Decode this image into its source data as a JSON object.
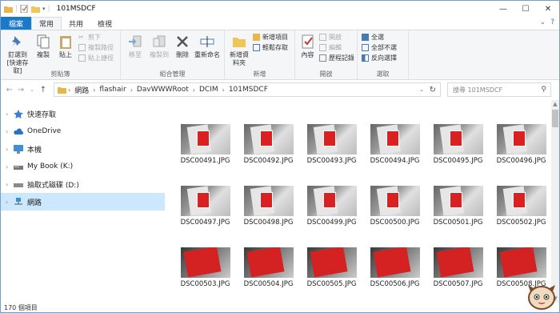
{
  "window": {
    "title": "101MSDCF",
    "controls": {
      "minimize": "—",
      "maximize": "☐",
      "close": "✕"
    }
  },
  "tabs": [
    {
      "label": "檔案"
    },
    {
      "label": "常用"
    },
    {
      "label": "共用"
    },
    {
      "label": "檢視"
    }
  ],
  "ribbon": {
    "clipboard": {
      "label": "剪貼簿",
      "pin": "釘選到 [快速存取]",
      "copy": "複製",
      "paste": "貼上",
      "cut": "剪下",
      "copy_path": "複製路徑",
      "paste_shortcut": "貼上捷徑"
    },
    "organize": {
      "label": "組合管理",
      "move_to": "移至",
      "copy_to": "複製到",
      "delete": "刪除",
      "rename": "重新命名"
    },
    "new": {
      "label": "新增",
      "new_folder": "新增資料夾",
      "new_item": "新增項目",
      "easy_access": "輕鬆存取"
    },
    "open": {
      "label": "開啟",
      "properties": "內容",
      "open": "開啟",
      "edit": "編輯",
      "history": "歷程記錄"
    },
    "select": {
      "label": "選取",
      "select_all": "全選",
      "select_none": "全部不選",
      "invert": "反向選擇"
    }
  },
  "address": {
    "crumbs": [
      "網路",
      "flashair",
      "DavWWWRoot",
      "DCIM",
      "101MSDCF"
    ],
    "search_placeholder": "搜尋 101MSDCF"
  },
  "sidebar": {
    "items": [
      {
        "label": "快速存取",
        "icon": "star-icon"
      },
      {
        "label": "OneDrive",
        "icon": "cloud-icon"
      },
      {
        "label": "本機",
        "icon": "computer-icon"
      },
      {
        "label": "My Book (K:)",
        "icon": "drive-icon"
      },
      {
        "label": "抽取式磁碟 (D:)",
        "icon": "removable-drive-icon"
      },
      {
        "label": "網路",
        "icon": "network-icon",
        "selected": true
      }
    ]
  },
  "files": [
    {
      "name": "DSC00491.JPG",
      "style": "card"
    },
    {
      "name": "DSC00492.JPG",
      "style": "card"
    },
    {
      "name": "DSC00493.JPG",
      "style": "card"
    },
    {
      "name": "DSC00494.JPG",
      "style": "card"
    },
    {
      "name": "DSC00495.JPG",
      "style": "card"
    },
    {
      "name": "DSC00496.JPG",
      "style": "card"
    },
    {
      "name": "DSC00497.JPG",
      "style": "card"
    },
    {
      "name": "DSC00498.JPG",
      "style": "card"
    },
    {
      "name": "DSC00499.JPG",
      "style": "card"
    },
    {
      "name": "DSC00500.JPG",
      "style": "card"
    },
    {
      "name": "DSC00501.JPG",
      "style": "card"
    },
    {
      "name": "DSC00502.JPG",
      "style": "card"
    },
    {
      "name": "DSC00503.JPG",
      "style": "red"
    },
    {
      "name": "DSC00504.JPG",
      "style": "red"
    },
    {
      "name": "DSC00505.JPG",
      "style": "red"
    },
    {
      "name": "DSC00506.JPG",
      "style": "red"
    },
    {
      "name": "DSC00507.JPG",
      "style": "red"
    },
    {
      "name": "DSC00508.JPG",
      "style": "red"
    }
  ],
  "status": {
    "count": "170 個項目"
  },
  "colors": {
    "file_tab": "#1979ca",
    "selected": "#cce8ff",
    "ribbon_bg": "#f5f6f7"
  }
}
